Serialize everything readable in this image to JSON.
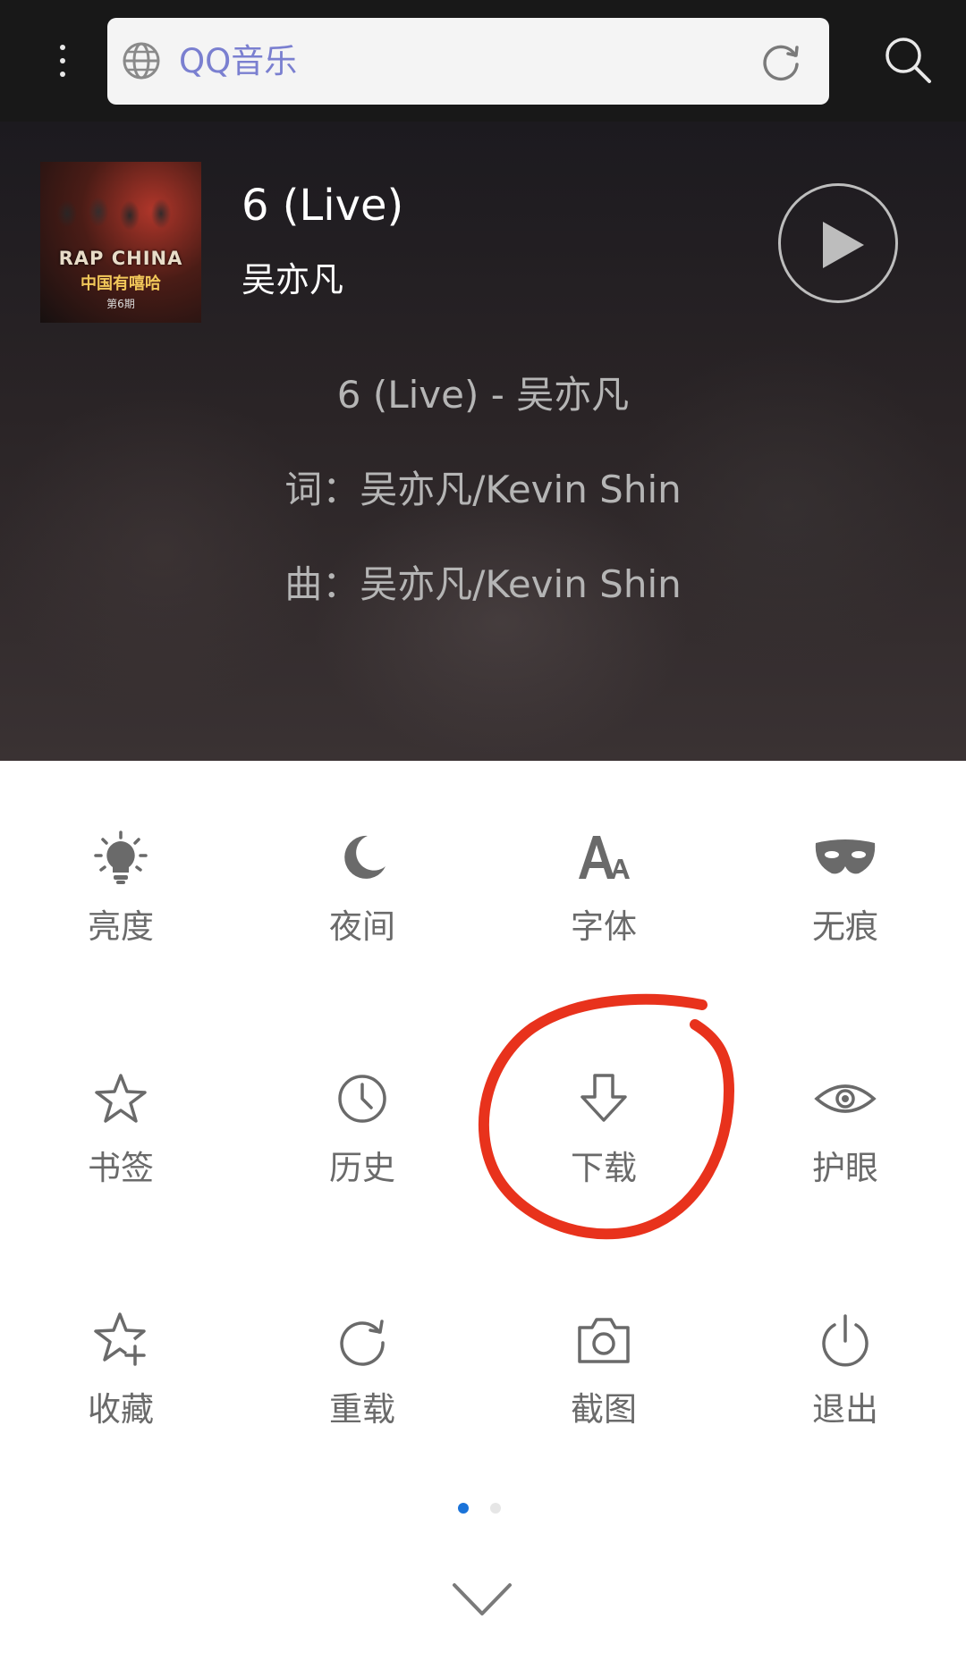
{
  "topbar": {
    "url_text": "QQ音乐",
    "menu_icon": "more-vertical-icon",
    "globe_icon": "globe-icon",
    "reload_icon": "reload-icon",
    "search_icon": "search-icon"
  },
  "player": {
    "cover": {
      "brand": "RAP CHINA",
      "subtitle": "中国有嘻哈",
      "issue": "第6期"
    },
    "title": "6 (Live)",
    "artist": "吴亦凡",
    "lyrics": [
      "6 (Live) - 吴亦凡",
      "词：吴亦凡/Kevin Shin",
      "曲：吴亦凡/Kevin Shin"
    ]
  },
  "menu": {
    "items": [
      {
        "label": "亮度",
        "icon": "brightness-icon"
      },
      {
        "label": "夜间",
        "icon": "moon-icon"
      },
      {
        "label": "字体",
        "icon": "font-icon"
      },
      {
        "label": "无痕",
        "icon": "mask-icon"
      },
      {
        "label": "书签",
        "icon": "star-icon"
      },
      {
        "label": "历史",
        "icon": "clock-icon"
      },
      {
        "label": "下载",
        "icon": "download-icon"
      },
      {
        "label": "护眼",
        "icon": "eye-icon"
      },
      {
        "label": "收藏",
        "icon": "star-plus-icon"
      },
      {
        "label": "重载",
        "icon": "reload-icon"
      },
      {
        "label": "截图",
        "icon": "camera-icon"
      },
      {
        "label": "退出",
        "icon": "power-icon"
      }
    ],
    "page_indicator": {
      "current": 1,
      "total": 2
    },
    "collapse_icon": "chevron-down-icon"
  },
  "colors": {
    "accent": "#1a73d9",
    "annotation": "#e8321c",
    "icon_gray": "#6a6a6a"
  }
}
